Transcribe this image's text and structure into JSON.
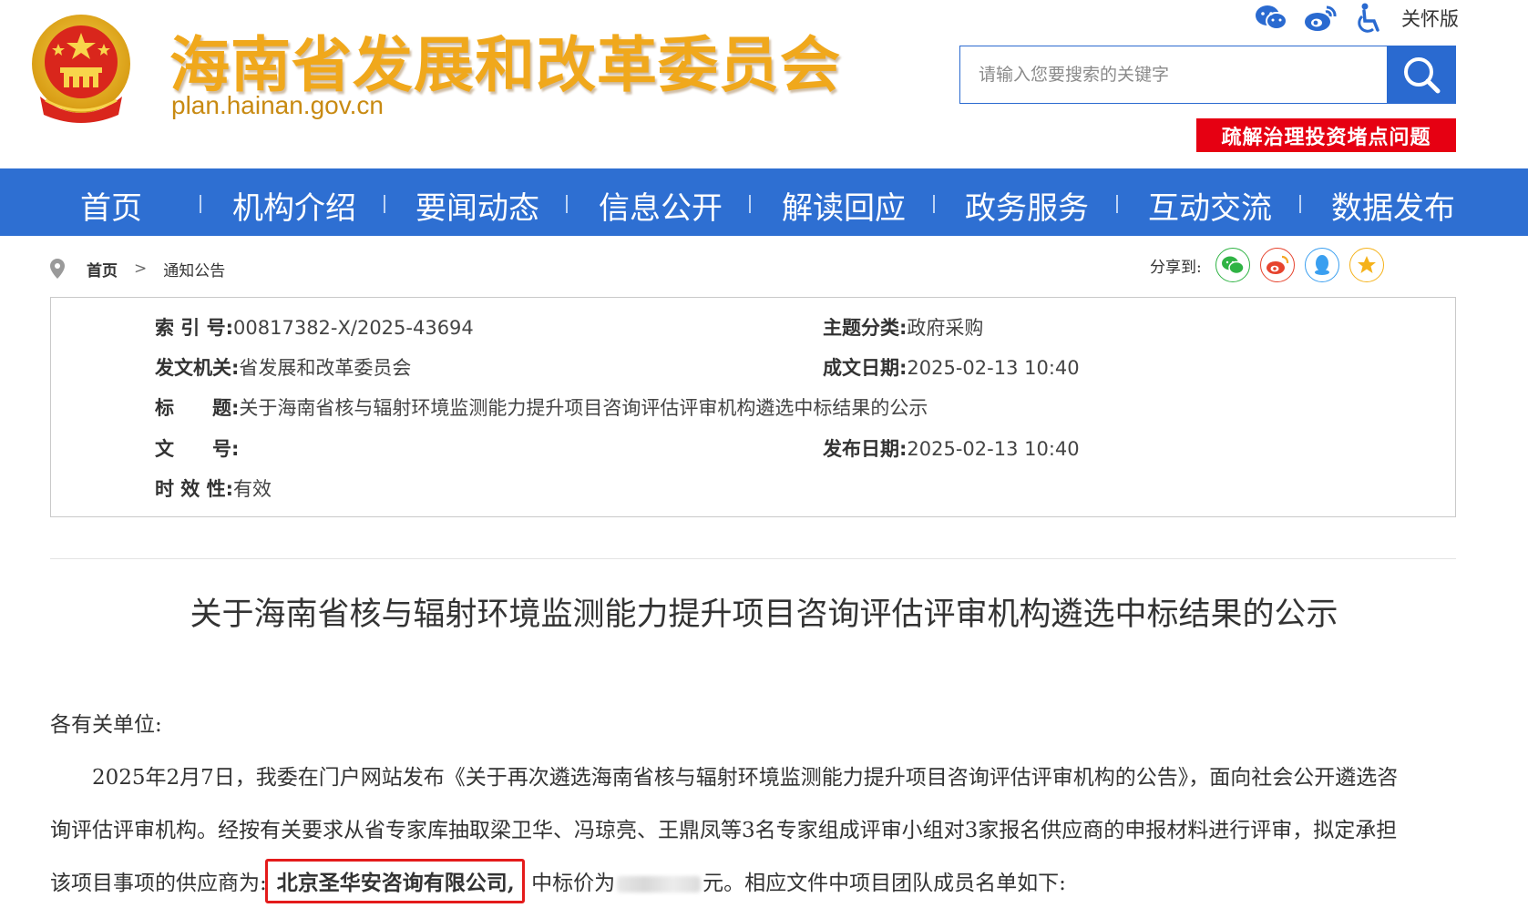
{
  "header": {
    "site_title": "海南省发展和改革委员会",
    "site_domain": "plan.hainan.gov.cn",
    "care_version": "关怀版",
    "search_placeholder": "请输入您要搜索的关键字",
    "promo_banner": "疏解治理投资堵点问题",
    "tool_icons": [
      "wechat-icon",
      "weibo-icon",
      "accessibility-icon"
    ]
  },
  "nav": {
    "items": [
      "首页",
      "机构介绍",
      "要闻动态",
      "信息公开",
      "解读回应",
      "政务服务",
      "互动交流",
      "数据发布"
    ]
  },
  "breadcrumb": {
    "home": "首页",
    "current": "通知公告"
  },
  "share": {
    "label": "分享到:",
    "targets": [
      "wechat",
      "weibo",
      "qq",
      "favorite"
    ],
    "colors": {
      "wechat": "#2fb344",
      "weibo": "#e6432d",
      "qq": "#3a9ff0",
      "favorite": "#f5b21a"
    }
  },
  "meta": {
    "index_label": "索 引 号:",
    "index_value": "00817382-X/2025-43694",
    "topic_label": "主题分类:",
    "topic_value": "政府采购",
    "issuer_label": "发文机关:",
    "issuer_value": "省发展和改革委员会",
    "created_label": "成文日期:",
    "created_value": "2025-02-13 10:40",
    "title_label": "标　　题:",
    "title_value": "关于海南省核与辐射环境监测能力提升项目咨询评估评审机构遴选中标结果的公示",
    "docno_label": "文　　号:",
    "docno_value": "",
    "published_label": "发布日期:",
    "published_value": "2025-02-13 10:40",
    "validity_label": "时 效 性:",
    "validity_value": "有效"
  },
  "article": {
    "title": "关于海南省核与辐射环境监测能力提升项目咨询评估评审机构遴选中标结果的公示",
    "salutation": "各有关单位:",
    "para1_line1": "2025年2月7日，我委在门户网站发布《关于再次遴选海南省核与辐射环境监测能力提升项目咨询评估评审机构的公告》，面向社会公开遴选咨",
    "para1_line2": "询评估评审机构。经按有关要求从省专家库抽取梁卫华、冯琼亮、王鼎凤等3名专家组成评审小组对3家报名供应商的申报材料进行评审，拟定承担",
    "para1_line3_prefix": "该项目事项的供应商为:",
    "winner": "北京圣华安咨询有限公司,",
    "price_prefix": "中标价为",
    "price_suffix": "元。相应文件中项目团队成员名单如下:"
  },
  "colors": {
    "nav_bg": "#2e6fd2",
    "title_gold": "#f0a81c",
    "promo_red": "#e60012",
    "highlight_red": "#e41b1b"
  }
}
